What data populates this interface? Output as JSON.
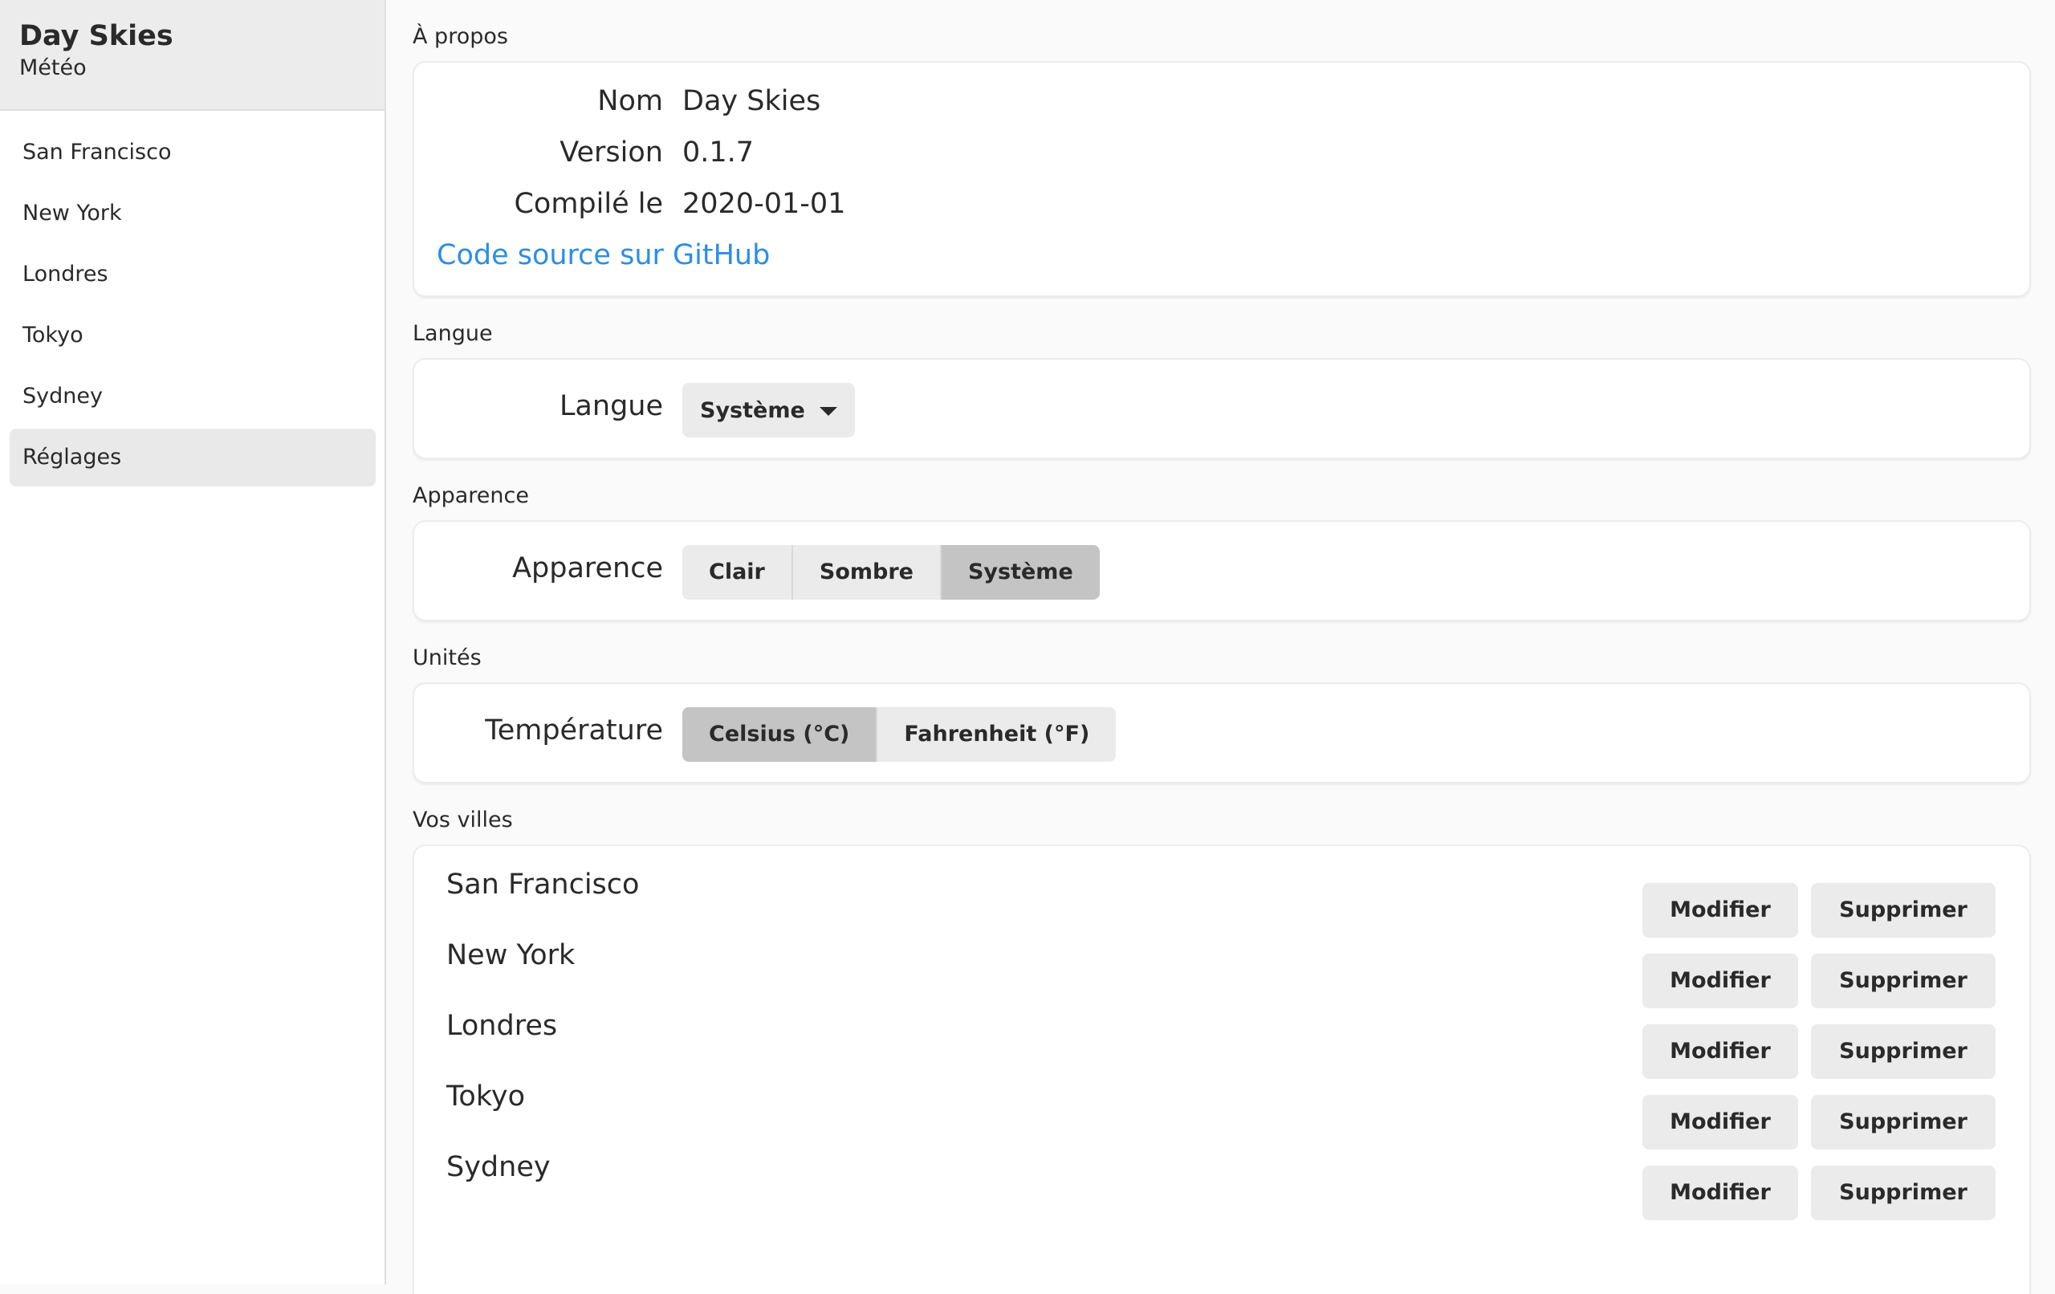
{
  "sidebar": {
    "app_title": "Day Skies",
    "app_subtitle": "Météo",
    "items": [
      {
        "label": "San Francisco",
        "active": false
      },
      {
        "label": "New York",
        "active": false
      },
      {
        "label": "Londres",
        "active": false
      },
      {
        "label": "Tokyo",
        "active": false
      },
      {
        "label": "Sydney",
        "active": false
      },
      {
        "label": "Réglages",
        "active": true
      }
    ]
  },
  "about": {
    "section_label": "À propos",
    "name_label": "Nom",
    "name_value": "Day Skies",
    "version_label": "Version",
    "version_value": "0.1.7",
    "build_label": "Compilé le",
    "build_value": "2020-01-01",
    "source_link": "Code source sur GitHub"
  },
  "language": {
    "section_label": "Langue",
    "row_label": "Langue",
    "selected": "Système"
  },
  "appearance": {
    "section_label": "Apparence",
    "row_label": "Apparence",
    "options": [
      "Clair",
      "Sombre",
      "Système"
    ],
    "selected": "Système"
  },
  "units": {
    "section_label": "Unités",
    "row_label": "Température",
    "options": [
      "Celsius (°C)",
      "Fahrenheit (°F)"
    ],
    "selected": "Celsius (°C)"
  },
  "cities": {
    "section_label": "Vos villes",
    "modify_label": "Modifier",
    "delete_label": "Supprimer",
    "items": [
      "San Francisco",
      "New York",
      "Londres",
      "Tokyo",
      "Sydney"
    ]
  },
  "colors": {
    "link": "#2b8ee8",
    "selected_segment": "#c4c4c4",
    "button_bg": "#ebebeb",
    "sidebar_active": "#e9e9e9"
  }
}
